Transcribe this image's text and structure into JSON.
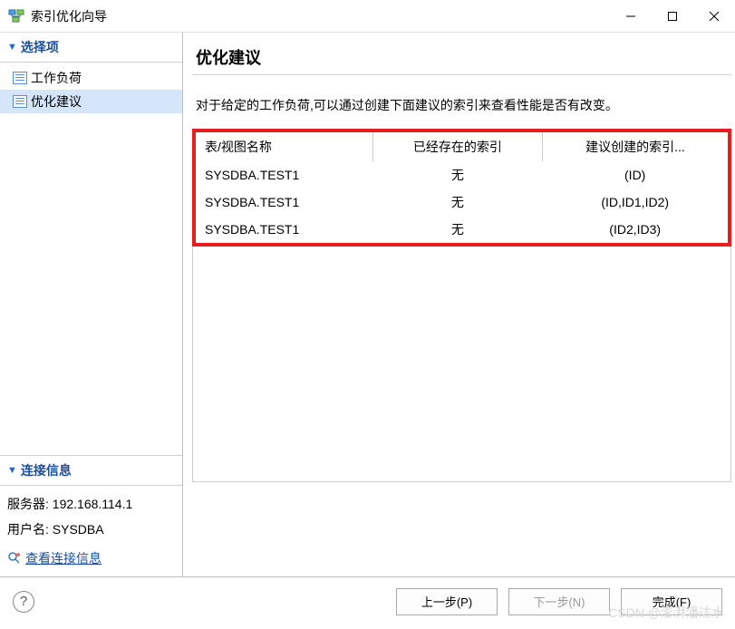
{
  "window": {
    "title": "索引优化向导"
  },
  "sidebar": {
    "select_panel_title": "选择项",
    "items": [
      {
        "label": "工作负荷"
      },
      {
        "label": "优化建议"
      }
    ],
    "connection_panel_title": "连接信息",
    "server_label": "服务器:",
    "server_value": "192.168.114.1",
    "user_label": "用户名:",
    "user_value": "SYSDBA",
    "view_connection_link": "查看连接信息"
  },
  "main": {
    "heading": "优化建议",
    "description": "对于给定的工作负荷,可以通过创建下面建议的索引来查看性能是否有改变。",
    "table": {
      "headers": [
        "表/视图名称",
        "已经存在的索引",
        "建议创建的索引..."
      ],
      "rows": [
        {
          "name": "SYSDBA.TEST1",
          "existing": "无",
          "suggested": "(ID)"
        },
        {
          "name": "SYSDBA.TEST1",
          "existing": "无",
          "suggested": "(ID,ID1,ID2)"
        },
        {
          "name": "SYSDBA.TEST1",
          "existing": "无",
          "suggested": "(ID2,ID3)"
        }
      ]
    }
  },
  "footer": {
    "back": "上一步(P)",
    "next": "下一步(N)",
    "finish": "完成(F)"
  },
  "watermark": "CSDN @澎湃潘达水"
}
